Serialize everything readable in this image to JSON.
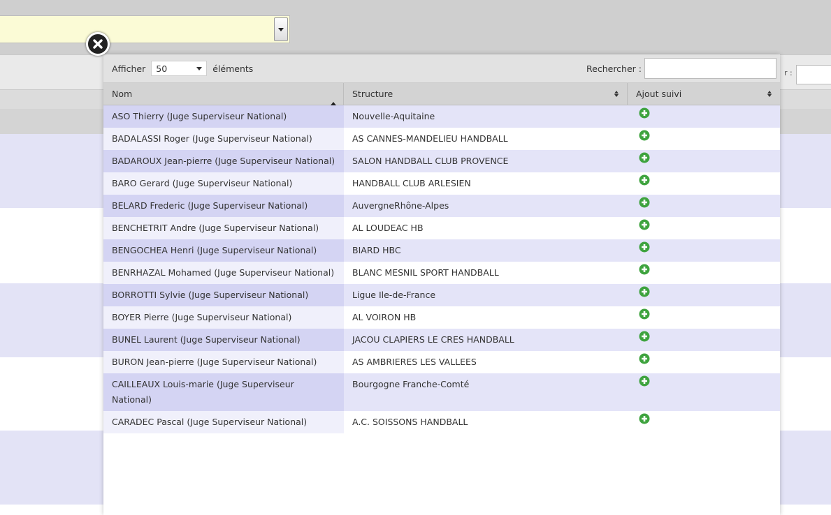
{
  "modal": {
    "length_prefix": "Afficher",
    "length_value": "50",
    "length_suffix": "éléments",
    "search_label": "Rechercher :",
    "search_value": "",
    "columns": [
      "Nom",
      "Structure",
      "Ajout suivi"
    ]
  },
  "background": {
    "search_label_fragment": "r :"
  },
  "rows": [
    {
      "nom": "ASO Thierry (Juge Superviseur National)",
      "structure": "Nouvelle-Aquitaine"
    },
    {
      "nom": "BADALASSI Roger (Juge Superviseur National)",
      "structure": "AS CANNES-MANDELIEU HANDBALL"
    },
    {
      "nom": "BADAROUX Jean-pierre (Juge Superviseur National)",
      "structure": "SALON HANDBALL CLUB PROVENCE"
    },
    {
      "nom": "BARO Gerard (Juge Superviseur National)",
      "structure": "HANDBALL CLUB ARLESIEN"
    },
    {
      "nom": "BELARD Frederic (Juge Superviseur National)",
      "structure": "AuvergneRhône-Alpes"
    },
    {
      "nom": "BENCHETRIT Andre (Juge Superviseur National)",
      "structure": "AL LOUDEAC HB"
    },
    {
      "nom": "BENGOCHEA Henri (Juge Superviseur National)",
      "structure": "BIARD HBC"
    },
    {
      "nom": "BENRHAZAL Mohamed (Juge Superviseur National)",
      "structure": "BLANC MESNIL SPORT HANDBALL"
    },
    {
      "nom": "BORROTTI Sylvie (Juge Superviseur National)",
      "structure": "Ligue Ile-de-France"
    },
    {
      "nom": "BOYER Pierre (Juge Superviseur National)",
      "structure": "AL VOIRON HB"
    },
    {
      "nom": "BUNEL Laurent (Juge Superviseur National)",
      "structure": "JACOU CLAPIERS LE CRES HANDBALL"
    },
    {
      "nom": "BURON Jean-pierre (Juge Superviseur National)",
      "structure": "AS AMBRIERES LES VALLEES"
    },
    {
      "nom": "CAILLEAUX Louis-marie (Juge Superviseur National)",
      "structure": "Bourgogne Franche-Comté"
    },
    {
      "nom": "CARADEC Pascal (Juge Superviseur National)",
      "structure": "A.C. SOISSONS HANDBALL"
    }
  ],
  "colors": {
    "odd_row": "#e4e4f8",
    "sorted_column": "#d4d4f3",
    "add_icon": "#3ea33e",
    "select_bg": "#fbfbd6"
  },
  "icons": {
    "close": "close-icon",
    "add": "plus-circle-icon",
    "sort_asc": "sort-asc-icon",
    "sort_both": "sort-both-icon"
  }
}
